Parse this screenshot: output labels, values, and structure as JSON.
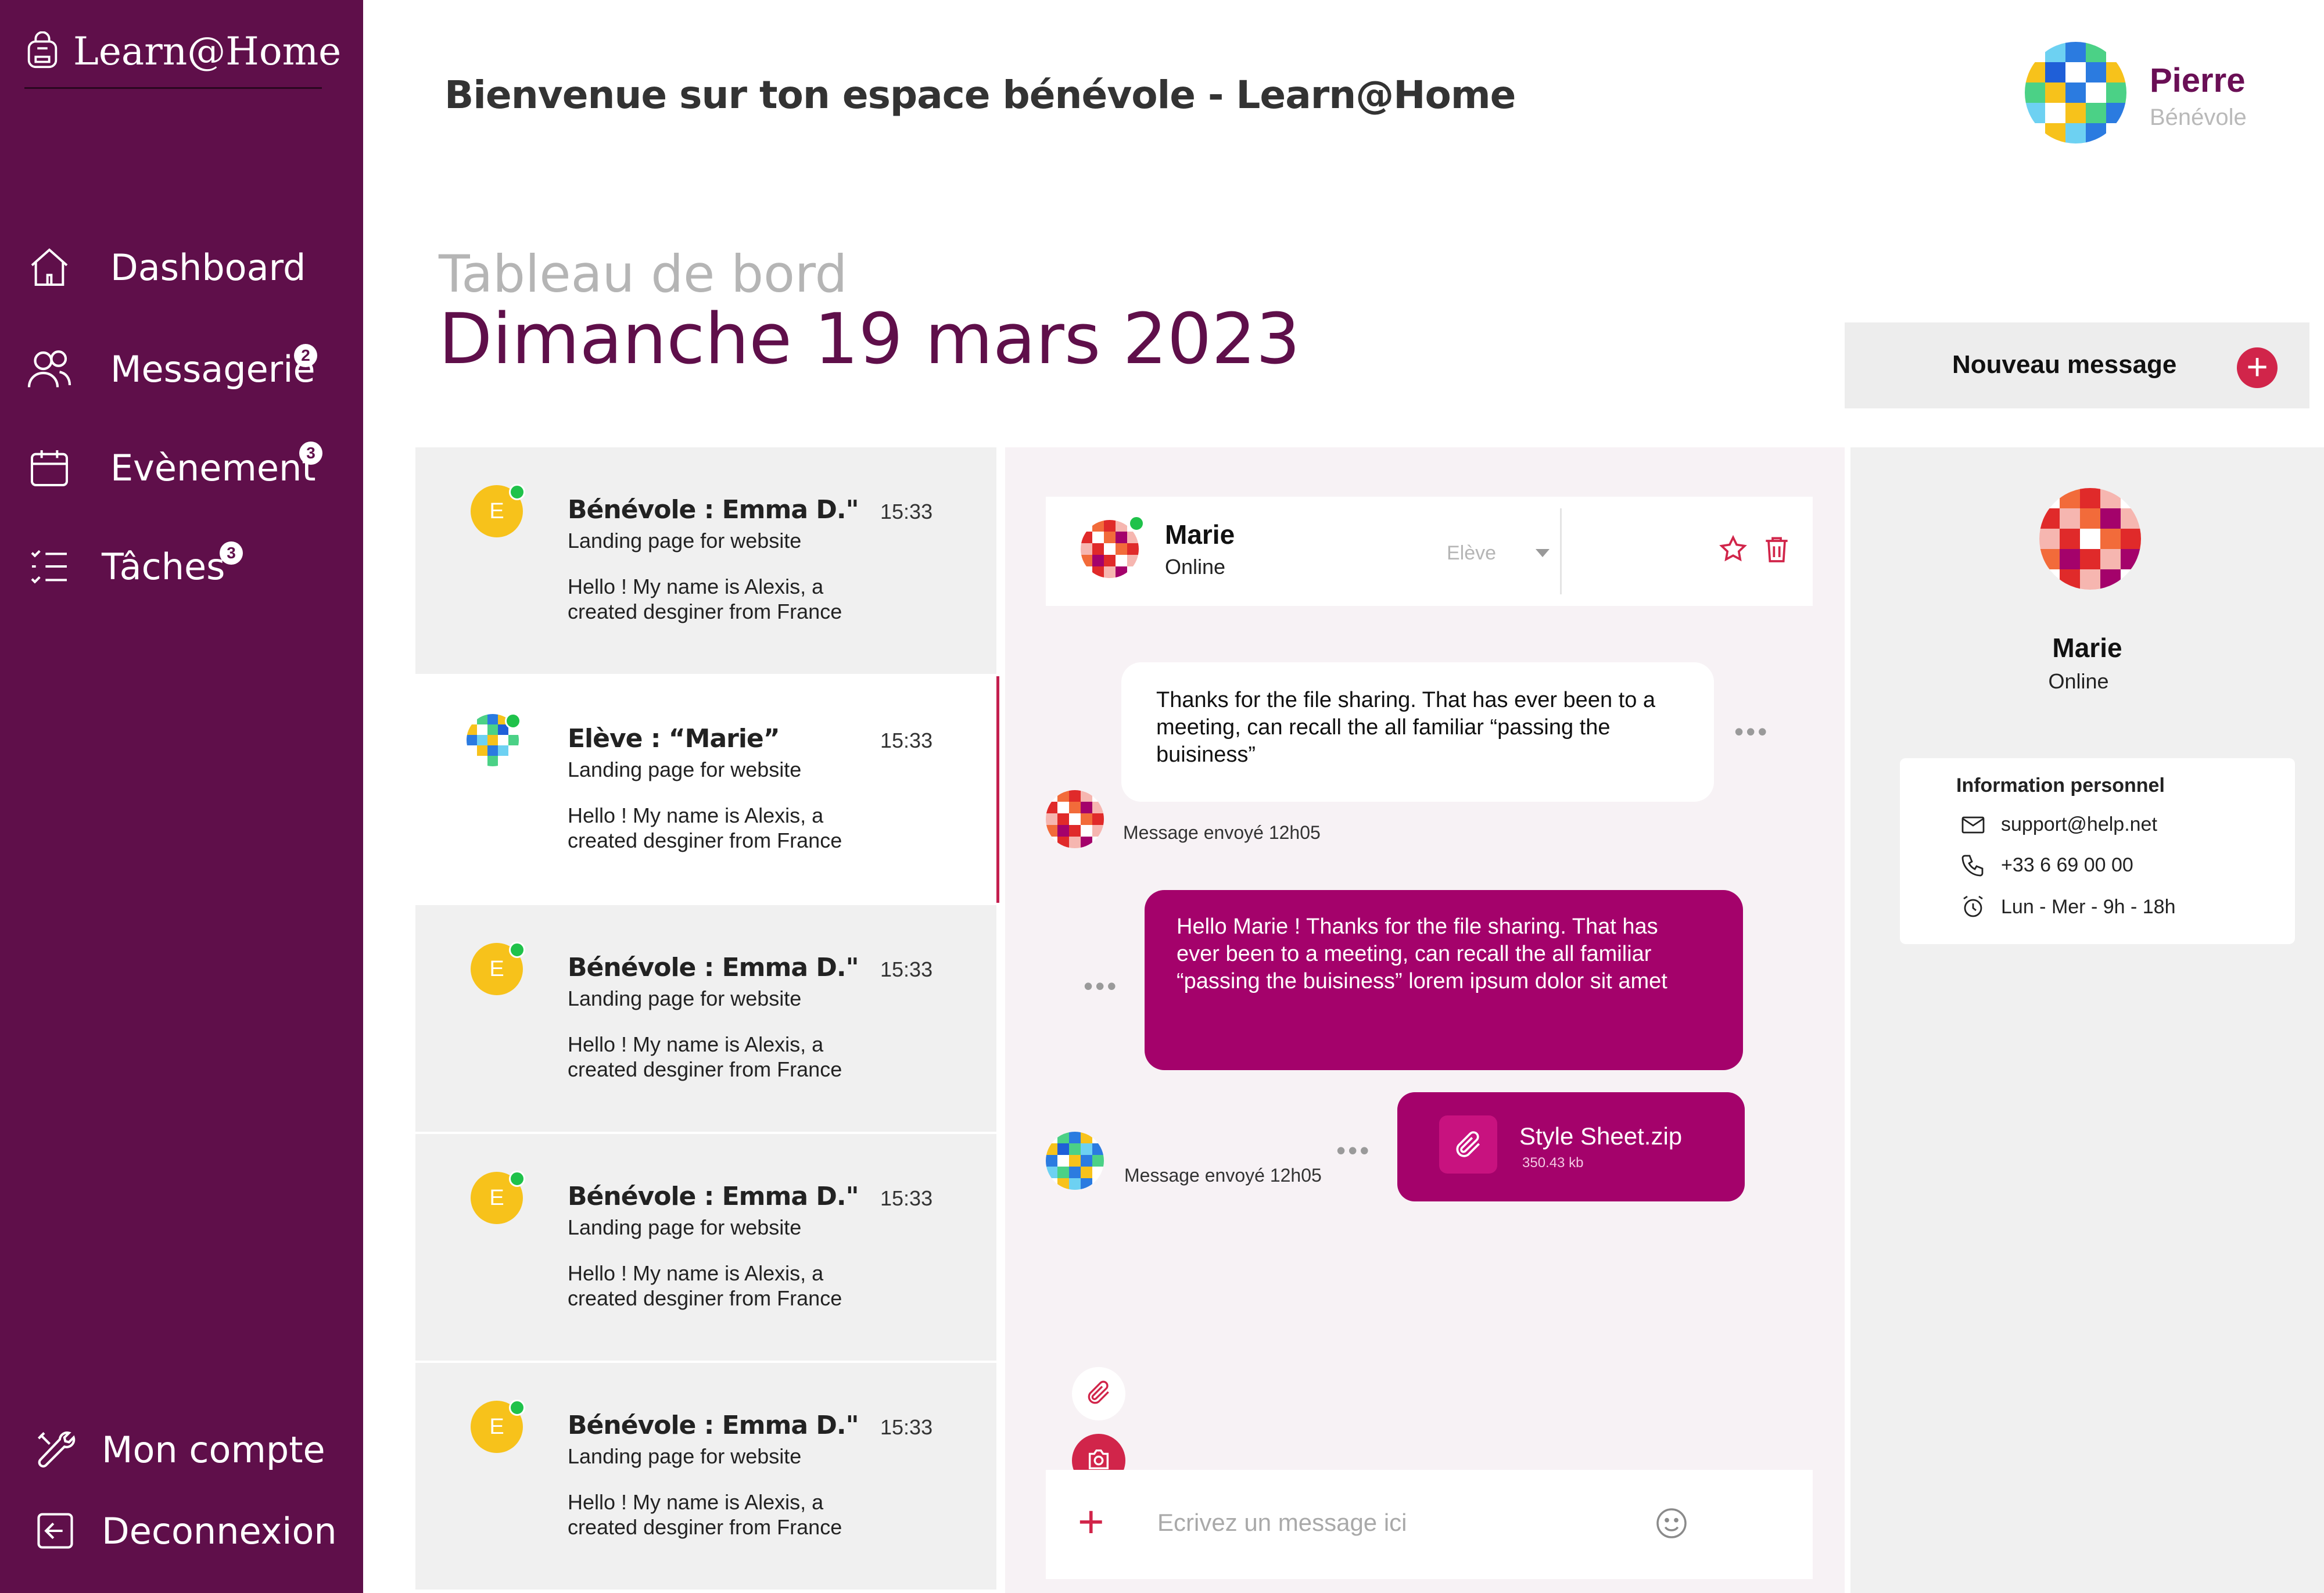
{
  "app": {
    "brand": "Learn@Home"
  },
  "sidebar": {
    "items": [
      {
        "label": "Dashboard",
        "icon": "home-icon",
        "badge": ""
      },
      {
        "label": "Messagerie",
        "icon": "users-icon",
        "badge": "2"
      },
      {
        "label": "Evènement",
        "icon": "calendar-icon",
        "badge": "3"
      },
      {
        "label": "Tâches",
        "icon": "tasks-icon",
        "badge": "3"
      }
    ],
    "bottom": [
      {
        "label": "Mon compte",
        "icon": "tools-icon"
      },
      {
        "label": "Deconnexion",
        "icon": "logout-icon"
      }
    ]
  },
  "header": {
    "title": "Bienvenue sur ton espace bénévole - Learn@Home",
    "user_name": "Pierre",
    "user_role": "Bénévole"
  },
  "board": {
    "label": "Tableau de bord",
    "date": "Dimanche 19 mars 2023"
  },
  "new_message": {
    "label": "Nouveau message",
    "icon": "plus-icon"
  },
  "conversations": [
    {
      "name": "Bénévole : Emma D.\"",
      "time": "15:33",
      "subject": "Landing page for website",
      "preview": "Hello ! My name is Alexis, a created desginer from France",
      "avatar_letter": "E",
      "active": false
    },
    {
      "name": "Elève : “Marie”",
      "time": "15:33",
      "subject": "Landing page for website",
      "preview": "Hello ! My name is Alexis, a created desginer from France",
      "avatar_letter": "",
      "active": true
    },
    {
      "name": "Bénévole : Emma D.\"",
      "time": "15:33",
      "subject": "Landing page for website",
      "preview": "Hello ! My name is Alexis, a created desginer from France",
      "avatar_letter": "E",
      "active": false
    },
    {
      "name": "Bénévole : Emma D.\"",
      "time": "15:33",
      "subject": "Landing page for website",
      "preview": "Hello ! My name is Alexis, a created desginer from France",
      "avatar_letter": "E",
      "active": false
    },
    {
      "name": "Bénévole : Emma D.\"",
      "time": "15:33",
      "subject": "Landing page for website",
      "preview": "Hello ! My name is Alexis, a created desginer from France",
      "avatar_letter": "E",
      "active": false
    }
  ],
  "chat": {
    "contact_name": "Marie",
    "contact_status": "Online",
    "contact_role": "Elève",
    "messages": [
      {
        "direction": "in",
        "text": "Thanks for the file sharing. That has ever been to a meeting, can recall the all familiar “passing the buisiness”",
        "meta": "Message envoyé 12h05"
      },
      {
        "direction": "out",
        "text": "Hello Marie ! Thanks for the file sharing. That has ever been to a meeting, can recall the all familiar “passing the buisiness” lorem ipsum dolor sit amet"
      },
      {
        "direction": "out",
        "file_name": "Style Sheet.zip",
        "file_size": "350.43 kb",
        "meta": "Message envoyé 12h05"
      }
    ],
    "composer_placeholder": "Ecrivez un message ici"
  },
  "profile": {
    "name": "Marie",
    "status": "Online",
    "info_title": "Information personnel",
    "email": "support@help.net",
    "phone": "+33 6 69 00 00",
    "hours": "Lun - Mer - 9h - 18h"
  },
  "colors": {
    "sidebar": "#5f0f4a",
    "accent": "#a4026b",
    "danger": "#d1254a",
    "online": "#1fc24a",
    "avatar_yellow": "#f7c21b"
  }
}
